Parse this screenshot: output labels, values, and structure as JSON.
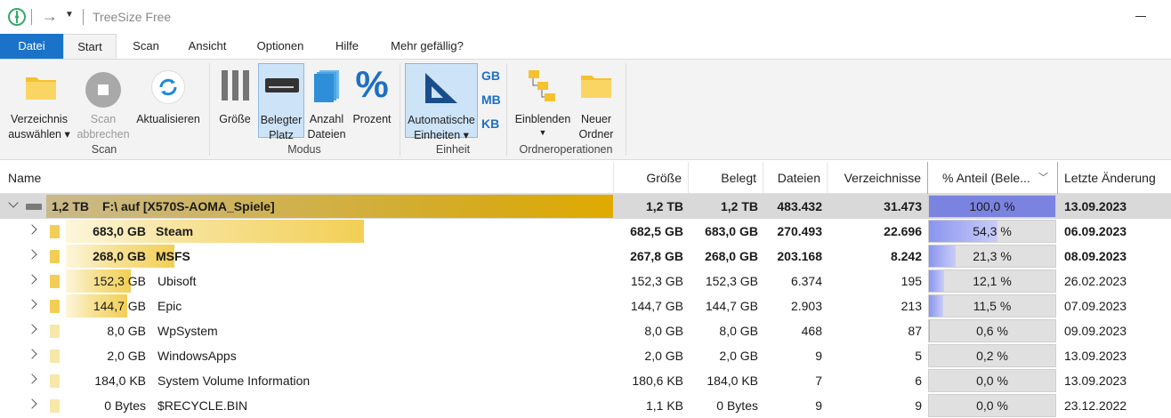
{
  "titlebar": {
    "app_title": "TreeSize Free"
  },
  "ribbon_tabs": [
    "Datei",
    "Start",
    "Scan",
    "Ansicht",
    "Optionen",
    "Hilfe",
    "Mehr gefällig?"
  ],
  "ribbon": {
    "scan_group": {
      "label": "Scan",
      "select_dir_1": "Verzeichnis",
      "select_dir_2": "auswählen",
      "stop_1": "Scan",
      "stop_2": "abbrechen",
      "refresh": "Aktualisieren"
    },
    "modus_group": {
      "label": "Modus",
      "size": "Größe",
      "alloc_1": "Belegter",
      "alloc_2": "Platz",
      "count_1": "Anzahl",
      "count_2": "Dateien",
      "percent": "Prozent"
    },
    "unit_group": {
      "label": "Einheit",
      "auto_1": "Automatische",
      "auto_2": "Einheiten",
      "gb": "GB",
      "mb": "MB",
      "kb": "KB"
    },
    "folder_group": {
      "label": "Ordneroperationen",
      "expand": "Einblenden",
      "new_1": "Neuer",
      "new_2": "Ordner"
    }
  },
  "columns": {
    "name": "Name",
    "size": "Größe",
    "allocated": "Belegt",
    "files": "Dateien",
    "dirs": "Verzeichnisse",
    "percent": "% Anteil (Bele...",
    "modified": "Letzte Änderung"
  },
  "root": {
    "size_label": "1,2 TB",
    "name": "F:\\  auf  [X570S-AOMA_Spiele]",
    "size": "1,2 TB",
    "allocated": "1,2 TB",
    "files": "483.432",
    "dirs": "31.473",
    "percent": "100,0 %",
    "percent_value": 100,
    "modified": "13.09.2023"
  },
  "rows": [
    {
      "size_label": "683,0 GB",
      "name": "Steam",
      "size": "682,5 GB",
      "allocated": "683,0 GB",
      "files": "270.493",
      "dirs": "22.696",
      "percent": "54,3 %",
      "percent_value": 54.3,
      "modified": "06.09.2023",
      "bold": true
    },
    {
      "size_label": "268,0 GB",
      "name": "MSFS",
      "size": "267,8 GB",
      "allocated": "268,0 GB",
      "files": "203.168",
      "dirs": "8.242",
      "percent": "21,3 %",
      "percent_value": 21.3,
      "modified": "08.09.2023",
      "bold": true
    },
    {
      "size_label": "152,3 GB",
      "name": "Ubisoft",
      "size": "152,3 GB",
      "allocated": "152,3 GB",
      "files": "6.374",
      "dirs": "195",
      "percent": "12,1 %",
      "percent_value": 12.1,
      "modified": "26.02.2023",
      "bold": false
    },
    {
      "size_label": "144,7 GB",
      "name": "Epic",
      "size": "144,7 GB",
      "allocated": "144,7 GB",
      "files": "2.903",
      "dirs": "213",
      "percent": "11,5 %",
      "percent_value": 11.5,
      "modified": "07.09.2023",
      "bold": false
    },
    {
      "size_label": "8,0 GB",
      "name": "WpSystem",
      "size": "8,0 GB",
      "allocated": "8,0 GB",
      "files": "468",
      "dirs": "87",
      "percent": "0,6 %",
      "percent_value": 0.6,
      "modified": "09.09.2023",
      "bold": false
    },
    {
      "size_label": "2,0 GB",
      "name": "WindowsApps",
      "size": "2,0 GB",
      "allocated": "2,0 GB",
      "files": "9",
      "dirs": "5",
      "percent": "0,2 %",
      "percent_value": 0.2,
      "modified": "13.09.2023",
      "bold": false
    },
    {
      "size_label": "184,0 KB",
      "name": "System Volume Information",
      "size": "180,6 KB",
      "allocated": "184,0 KB",
      "files": "7",
      "dirs": "6",
      "percent": "0,0 %",
      "percent_value": 0.0,
      "modified": "13.09.2023",
      "bold": false
    },
    {
      "size_label": "0 Bytes",
      "name": "$RECYCLE.BIN",
      "size": "1,1 KB",
      "allocated": "0 Bytes",
      "files": "9",
      "dirs": "9",
      "percent": "0,0 %",
      "percent_value": 0.0,
      "modified": "23.12.2022",
      "bold": false
    }
  ],
  "colors": {
    "accent": "#1a73c8",
    "size_bar": "#f2cf55",
    "percent_fill": "#7b83e0"
  }
}
